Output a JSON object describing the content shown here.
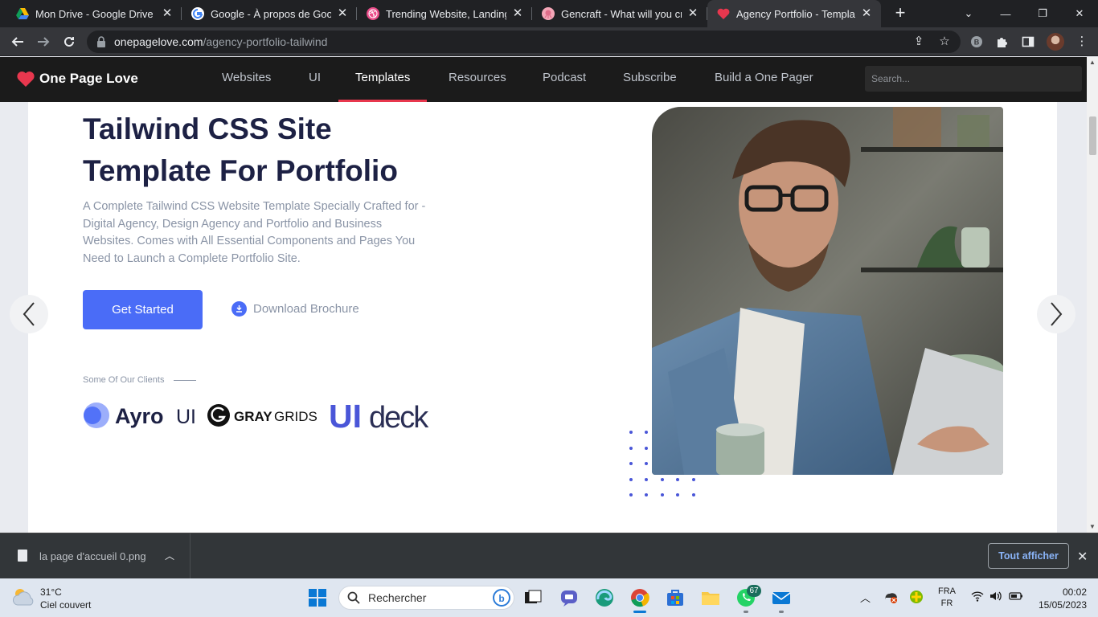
{
  "browser": {
    "tabs": [
      {
        "title": "Mon Drive - Google Drive",
        "favicon": "google-drive-icon",
        "active": false
      },
      {
        "title": "Google - À propos de Google",
        "favicon": "google-icon",
        "active": false
      },
      {
        "title": "Trending Website, Landing Pa",
        "favicon": "dribbble-icon",
        "active": false
      },
      {
        "title": "Gencraft - What will you crea",
        "favicon": "gencraft-icon",
        "active": false
      },
      {
        "title": "Agency Portfolio - Template f",
        "favicon": "heart-icon",
        "active": true
      }
    ],
    "url_domain": "onepagelove.com",
    "url_path": "/agency-portfolio-tailwind"
  },
  "site": {
    "logo_text": "One Page Love",
    "nav": [
      "Websites",
      "UI",
      "Templates",
      "Resources",
      "Podcast",
      "Subscribe",
      "Build a One Pager"
    ],
    "active_nav": "Templates",
    "search_placeholder": "Search..."
  },
  "hero": {
    "headline_line1": "Tailwind CSS Site",
    "headline_line2": "Template For Portfolio",
    "description": "A Complete Tailwind CSS Website Template Specially Crafted for - Digital Agency, Design Agency and Portfolio and Business Websites. Comes with All Essential Components and Pages You Need to Launch a Complete Portfolio Site.",
    "primary_button": "Get Started",
    "secondary_button": "Download Brochure",
    "clients_label": "Some Of Our Clients",
    "clients": [
      {
        "name_bold": "Ayro",
        "name_light": "UI"
      },
      {
        "name_bold": "GRAY",
        "name_light": "GRIDS"
      },
      {
        "name_bold": "UI",
        "name_light": "deck"
      }
    ],
    "accent_color": "#4a6cf7",
    "heading_color": "#1d2144"
  },
  "downloads": {
    "file_name": "la page d'accueil 0.png",
    "show_all": "Tout afficher"
  },
  "taskbar": {
    "temperature": "31°C",
    "weather": "Ciel couvert",
    "search_placeholder": "Rechercher",
    "whatsapp_badge": "67",
    "lang_top": "FRA",
    "lang_bottom": "FR",
    "time": "00:02",
    "date": "15/05/2023"
  }
}
